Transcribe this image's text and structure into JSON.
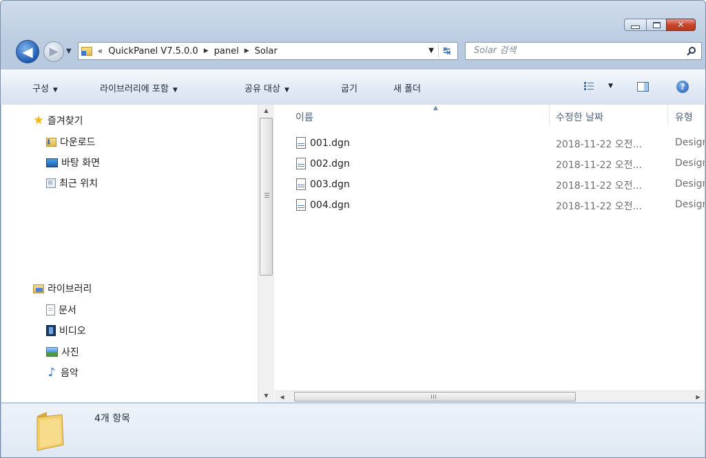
{
  "window": {
    "close_glyph": "✕"
  },
  "nav": {
    "back_glyph": "◀",
    "forward_glyph": "▶",
    "breadcrumb_overflow": "«",
    "crumbs": [
      "QuickPanel V7.5.0.0",
      "panel",
      "Solar"
    ],
    "search_placeholder": "Solar 검색"
  },
  "toolbar": {
    "organize": "구성",
    "include_library": "라이브러리에 포함",
    "share_with": "공유 대상",
    "burn": "굽기",
    "new_folder": "새 폴더",
    "help_glyph": "?"
  },
  "sidebar": {
    "favorites": {
      "label": "즐겨찾기",
      "items": [
        {
          "label": "다운로드",
          "icon": "downloads-icon"
        },
        {
          "label": "바탕 화면",
          "icon": "desktop-icon"
        },
        {
          "label": "최근 위치",
          "icon": "recent-places-icon"
        }
      ]
    },
    "libraries": {
      "label": "라이브러리",
      "items": [
        {
          "label": "문서",
          "icon": "documents-icon"
        },
        {
          "label": "비디오",
          "icon": "videos-icon"
        },
        {
          "label": "사진",
          "icon": "pictures-icon"
        },
        {
          "label": "음악",
          "icon": "music-icon"
        }
      ]
    }
  },
  "file_list": {
    "columns": {
      "name": "이름",
      "date_modified": "수정한 날짜",
      "type": "유형"
    },
    "rows": [
      {
        "name": "001.dgn",
        "date": "2018-11-22 오전...",
        "type": "Design"
      },
      {
        "name": "002.dgn",
        "date": "2018-11-22 오전...",
        "type": "Design"
      },
      {
        "name": "003.dgn",
        "date": "2018-11-22 오전...",
        "type": "Design"
      },
      {
        "name": "004.dgn",
        "date": "2018-11-22 오전...",
        "type": "Design"
      }
    ]
  },
  "status": {
    "item_count": "4개 항목"
  },
  "colors": {
    "accent": "#1d5ab0",
    "close_button": "#c8452a",
    "folder": "#e5b84a"
  }
}
